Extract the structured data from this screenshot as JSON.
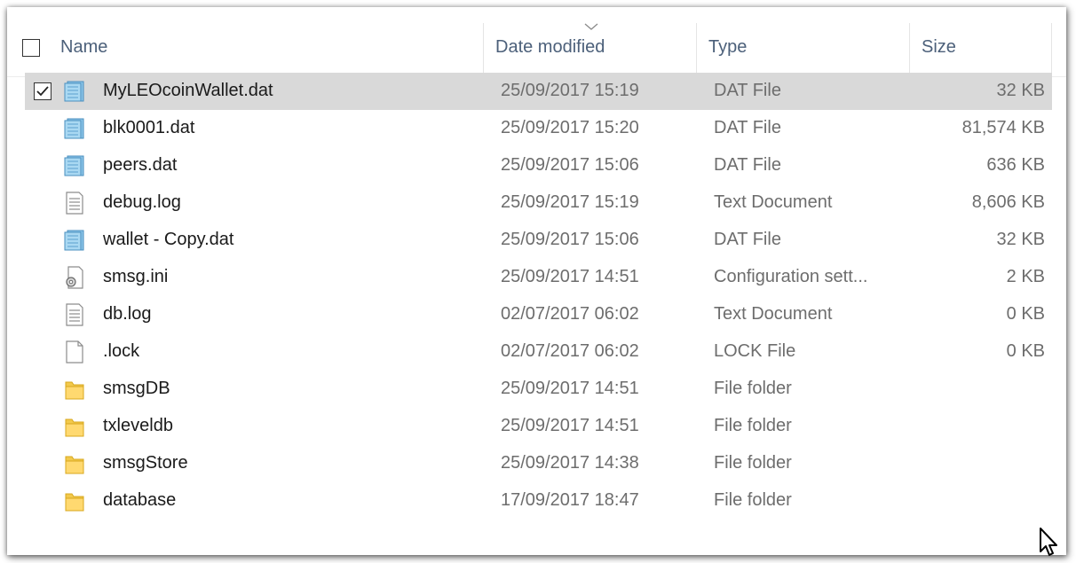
{
  "columns": {
    "name": "Name",
    "date": "Date modified",
    "type": "Type",
    "size": "Size"
  },
  "files": [
    {
      "name": "MyLEOcoinWallet.dat",
      "date": "25/09/2017 15:19",
      "type": "DAT File",
      "size": "32 KB",
      "icon": "dat-file-icon",
      "selected": true,
      "checked": true
    },
    {
      "name": "blk0001.dat",
      "date": "25/09/2017 15:20",
      "type": "DAT File",
      "size": "81,574 KB",
      "icon": "dat-file-icon"
    },
    {
      "name": "peers.dat",
      "date": "25/09/2017 15:06",
      "type": "DAT File",
      "size": "636 KB",
      "icon": "dat-file-icon"
    },
    {
      "name": "debug.log",
      "date": "25/09/2017 15:19",
      "type": "Text Document",
      "size": "8,606 KB",
      "icon": "text-document-icon"
    },
    {
      "name": "wallet - Copy.dat",
      "date": "25/09/2017 15:06",
      "type": "DAT File",
      "size": "32 KB",
      "icon": "dat-file-icon"
    },
    {
      "name": "smsg.ini",
      "date": "25/09/2017 14:51",
      "type": "Configuration sett...",
      "size": "2 KB",
      "icon": "config-file-icon"
    },
    {
      "name": "db.log",
      "date": "02/07/2017 06:02",
      "type": "Text Document",
      "size": "0 KB",
      "icon": "text-document-icon"
    },
    {
      "name": ".lock",
      "date": "02/07/2017 06:02",
      "type": "LOCK File",
      "size": "0 KB",
      "icon": "blank-file-icon"
    },
    {
      "name": "smsgDB",
      "date": "25/09/2017 14:51",
      "type": "File folder",
      "size": "",
      "icon": "folder-icon"
    },
    {
      "name": "txleveldb",
      "date": "25/09/2017 14:51",
      "type": "File folder",
      "size": "",
      "icon": "folder-icon"
    },
    {
      "name": "smsgStore",
      "date": "25/09/2017 14:38",
      "type": "File folder",
      "size": "",
      "icon": "folder-icon"
    },
    {
      "name": "database",
      "date": "17/09/2017 18:47",
      "type": "File folder",
      "size": "",
      "icon": "folder-icon"
    }
  ],
  "colors": {
    "header_text": "#4c607a",
    "selected_row": "#d9d9d9",
    "secondary_text": "#6d6d6d"
  }
}
